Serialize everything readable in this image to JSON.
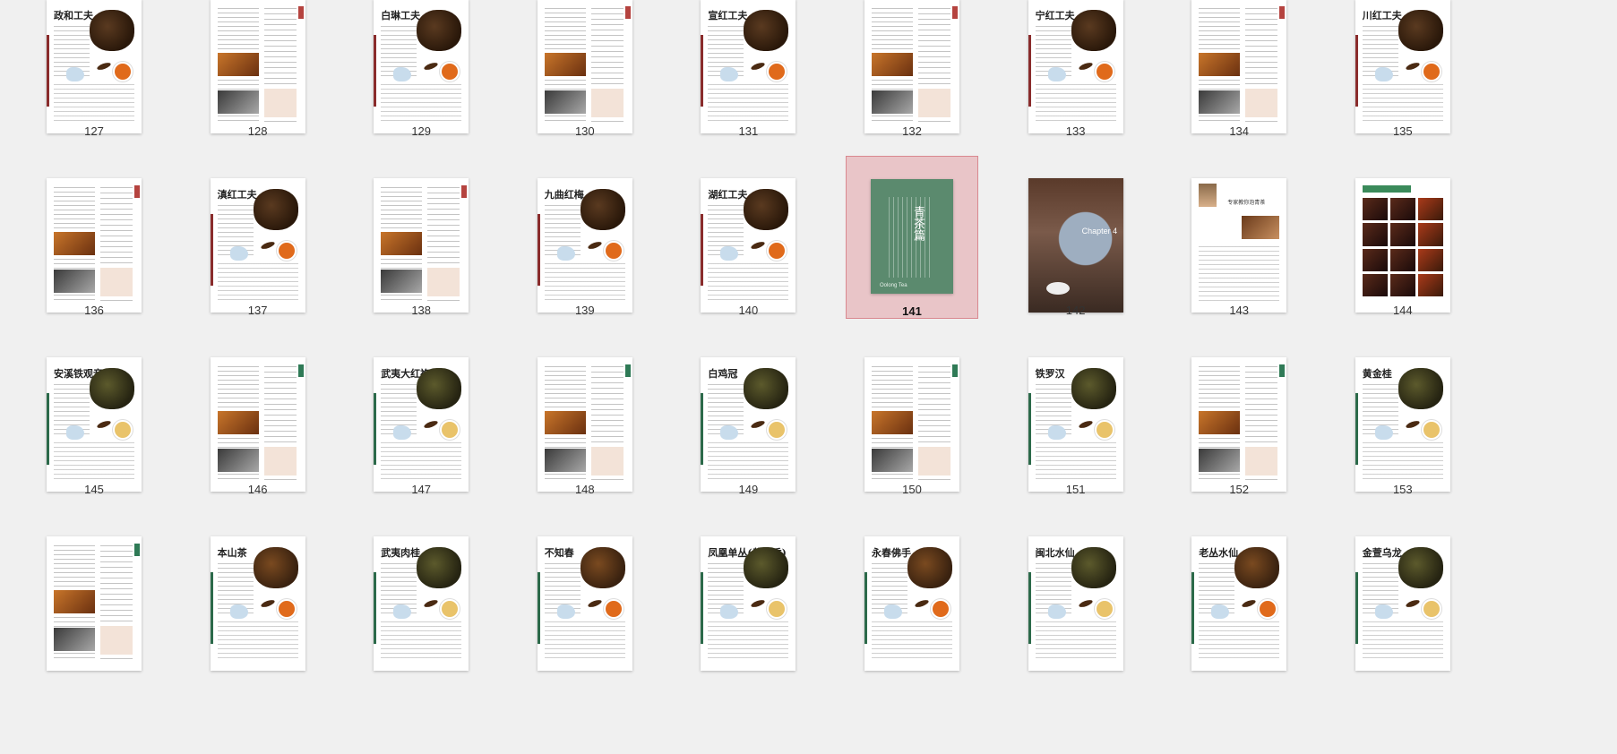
{
  "selected_page": "141",
  "rows": [
    [
      {
        "num": "127",
        "title": "政和工夫",
        "kind": "tea"
      },
      {
        "num": "128",
        "title": "",
        "kind": "detail"
      },
      {
        "num": "129",
        "title": "白琳工夫",
        "kind": "tea"
      },
      {
        "num": "130",
        "title": "",
        "kind": "detail"
      },
      {
        "num": "131",
        "title": "宣红工夫",
        "kind": "tea"
      },
      {
        "num": "132",
        "title": "",
        "kind": "detail"
      },
      {
        "num": "133",
        "title": "宁红工夫",
        "kind": "tea"
      },
      {
        "num": "134",
        "title": "",
        "kind": "detail"
      },
      {
        "num": "135",
        "title": "川红工夫",
        "kind": "tea"
      }
    ],
    [
      {
        "num": "136",
        "title": "",
        "kind": "detail"
      },
      {
        "num": "137",
        "title": "滇红工夫",
        "kind": "tea"
      },
      {
        "num": "138",
        "title": "",
        "kind": "detail"
      },
      {
        "num": "139",
        "title": "九曲红梅",
        "kind": "tea"
      },
      {
        "num": "140",
        "title": "湖红工夫",
        "kind": "tea"
      },
      {
        "num": "141",
        "title": "青茶篇",
        "kind": "cover"
      },
      {
        "num": "142",
        "title": "Chapter 4",
        "kind": "opener"
      },
      {
        "num": "143",
        "title": "专家教你泡青茶",
        "kind": "interview"
      },
      {
        "num": "144",
        "title": "",
        "kind": "grid"
      }
    ],
    [
      {
        "num": "145",
        "title": "安溪铁观音",
        "kind": "tea"
      },
      {
        "num": "146",
        "title": "",
        "kind": "detail"
      },
      {
        "num": "147",
        "title": "武夷大红袍",
        "kind": "tea"
      },
      {
        "num": "148",
        "title": "",
        "kind": "detail"
      },
      {
        "num": "149",
        "title": "白鸡冠",
        "kind": "tea"
      },
      {
        "num": "150",
        "title": "",
        "kind": "detail"
      },
      {
        "num": "151",
        "title": "铁罗汉",
        "kind": "tea"
      },
      {
        "num": "152",
        "title": "",
        "kind": "detail"
      },
      {
        "num": "153",
        "title": "黄金桂",
        "kind": "tea"
      }
    ],
    [
      {
        "num": "",
        "title": "",
        "kind": "detail"
      },
      {
        "num": "",
        "title": "本山茶",
        "kind": "tea"
      },
      {
        "num": "",
        "title": "武夷肉桂",
        "kind": "tea"
      },
      {
        "num": "",
        "title": "不知春",
        "kind": "tea"
      },
      {
        "num": "",
        "title": "凤凰单丛(黄枝香)",
        "kind": "tea"
      },
      {
        "num": "",
        "title": "永春佛手",
        "kind": "tea"
      },
      {
        "num": "",
        "title": "闽北水仙",
        "kind": "tea"
      },
      {
        "num": "",
        "title": "老丛水仙",
        "kind": "tea"
      },
      {
        "num": "",
        "title": "金萱乌龙",
        "kind": "tea"
      }
    ]
  ]
}
